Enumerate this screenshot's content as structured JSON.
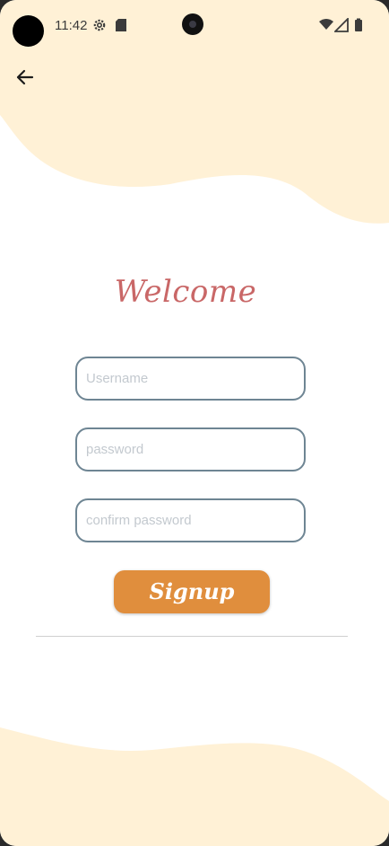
{
  "status_bar": {
    "time": "11:42"
  },
  "icons": {
    "back": "arrow-left-icon",
    "settings": "gear-icon",
    "sd_card": "sd-card-icon",
    "wifi": "wifi-icon",
    "signal": "signal-icon",
    "battery": "battery-icon"
  },
  "colors": {
    "wave": "#fff1d6",
    "title": "#c96767",
    "field_border": "#6e8593",
    "button": "#e08e3d"
  },
  "form": {
    "title": "Welcome",
    "username_placeholder": "Username",
    "password_placeholder": "password",
    "confirm_placeholder": "confirm password",
    "signup_label": "Signup"
  }
}
